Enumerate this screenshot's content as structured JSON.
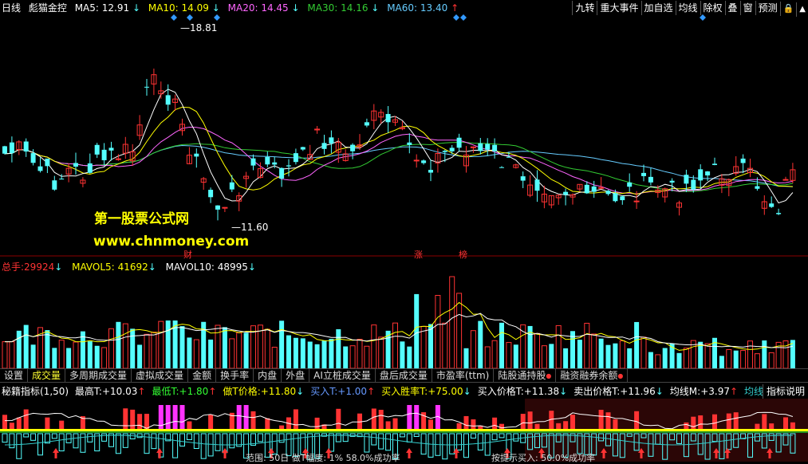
{
  "header": {
    "period": "日线",
    "stock_name": "彪猫金控",
    "ma5": {
      "label": "MA5:",
      "value": "12.91",
      "arrow": "↓",
      "color": "#ffffff"
    },
    "ma10": {
      "label": "MA10:",
      "value": "14.09",
      "arrow": "↓",
      "color": "#ffff00"
    },
    "ma20": {
      "label": "MA20:",
      "value": "14.45",
      "arrow": "↓",
      "color": "#ff66ff"
    },
    "ma30": {
      "label": "MA30:",
      "value": "14.16",
      "arrow": "↓",
      "color": "#33cc33"
    },
    "ma60": {
      "label": "MA60:",
      "value": "13.40",
      "arrow": "↑",
      "color": "#66ccff"
    },
    "buttons": [
      "九转",
      "重大事件",
      "加自选",
      "均线",
      "除权",
      "叠",
      "窗",
      "预测"
    ]
  },
  "price_chart": {
    "high_label": "18.81",
    "low_label": "11.60",
    "watermark_title": "第一股票公式网",
    "watermark_url": "www.chnmoney.com",
    "markers": [
      "财",
      "涨",
      "榜"
    ]
  },
  "volume": {
    "label": "总手:",
    "value": "29924",
    "arrow": "↓",
    "mavol5_label": "MAVOL5:",
    "mavol5_value": "41692",
    "mavol5_arrow": "↓",
    "mavol10_label": "MAVOL10:",
    "mavol10_value": "48995",
    "mavol10_arrow": "↓"
  },
  "tabs": [
    {
      "label": "设置",
      "dot": false
    },
    {
      "label": "成交量",
      "dot": false,
      "active": true
    },
    {
      "label": "多周期成交量",
      "dot": false
    },
    {
      "label": "虚拟成交量",
      "dot": false
    },
    {
      "label": "金额",
      "dot": false
    },
    {
      "label": "换手率",
      "dot": false
    },
    {
      "label": "内盘",
      "dot": false
    },
    {
      "label": "外盘",
      "dot": false
    },
    {
      "label": "AI立桩成交量",
      "dot": false
    },
    {
      "label": "盘后成交量",
      "dot": false
    },
    {
      "label": "市盈率(ttm)",
      "dot": false
    },
    {
      "label": "陆股通持股",
      "dot": true
    },
    {
      "label": "融资融券余额",
      "dot": true
    }
  ],
  "indicator": {
    "name": "秘籍指标(1,50)",
    "items": [
      {
        "label": "最高T:",
        "value": "+10.03",
        "arrow": "↑",
        "color": "#ffffff"
      },
      {
        "label": "最低T:",
        "value": "+1.80",
        "arrow": "↑",
        "color": "#33ff33"
      },
      {
        "label": "做T价格:",
        "value": "+11.80",
        "arrow": "↓",
        "color": "#ffff00"
      },
      {
        "label": "买入T:",
        "value": "+1.00",
        "arrow": "↑",
        "color": "#6699ff"
      },
      {
        "label": "买入胜率T:",
        "value": "+75.00",
        "arrow": "↓",
        "color": "#ffff00"
      },
      {
        "label": "买入价格T:",
        "value": "+11.38",
        "arrow": "↓",
        "color": "#ffffff"
      },
      {
        "label": "卖出价格T:",
        "value": "+11.96",
        "arrow": "↓",
        "color": "#ffffff"
      },
      {
        "label": "均线M:",
        "value": "+3.97",
        "arrow": "↑",
        "color": "#ffffff"
      },
      {
        "label": "均线L:",
        "value": "-5.04",
        "arrow": "↓",
        "color": "#33cccc"
      }
    ],
    "help_button": "指标说明",
    "footer_left": "范围: 50日 做T幅度: 1% 58.0%成功率",
    "footer_right": "按提示买入: 50.0%成功率"
  },
  "colors": {
    "up": "#ff3333",
    "down": "#54ffff",
    "diamond": "#3399ff",
    "magenta": "#ff33ff",
    "panel_bg": "#000000"
  }
}
